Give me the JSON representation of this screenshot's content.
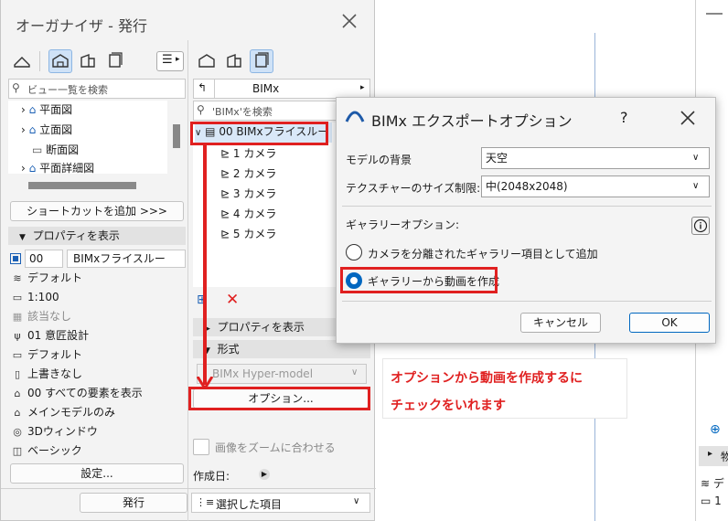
{
  "organizer": {
    "title": "オーガナイザ - 発行",
    "search_views_placeholder": "ビュー一覧を検索",
    "tree_left": [
      "平面図",
      "立面図",
      "断面図",
      "平面詳細図"
    ],
    "add_shortcut": "ショートカットを追加 >>>",
    "show_properties": "プロパティを表示",
    "prop_id": "00",
    "prop_name": "BIMxフライスルー",
    "properties": [
      "デフォルト",
      "1:100",
      "該当なし",
      "01 意匠設計",
      "デフォルト",
      "上書きなし",
      "00 すべての要素を表示",
      "メインモデルのみ",
      "3Dウィンドウ",
      "ベーシック"
    ],
    "settings_button": "設定...",
    "publish_button": "発行",
    "right_dropdown": "BIMx",
    "search_bimx_placeholder": "'BIMx'を検索",
    "set_item": "00 BIMxフライスルー",
    "cameras": [
      "1 カメラ",
      "2 カメラ",
      "3 カメラ",
      "4 カメラ",
      "5 カメラ"
    ],
    "right_show_properties": "プロパティを表示",
    "format_header": "形式",
    "format_value": "BIMx Hyper-model",
    "options_button": "オプション...",
    "fit_zoom": "画像をズームに合わせる",
    "created_date": "作成日:",
    "selected_items": "選択した項目"
  },
  "dialog": {
    "title": "BIMx エクスポートオプション",
    "help": "?",
    "model_bg_label": "モデルの背景",
    "model_bg_value": "天空",
    "texture_label": "テクスチャーのサイズ制限:",
    "texture_value": "中(2048x2048)",
    "gallery_label": "ギャラリーオプション:",
    "radio1": "カメラを分離されたギャラリー項目として追加",
    "radio2": "ギャラリーから動画を作成",
    "cancel": "キャンセル",
    "ok": "OK"
  },
  "annotation": {
    "line1": "オプションから動画を作成するに",
    "line2": "チェックをいれます"
  },
  "background": {
    "col_label_1": "物",
    "col_label_2": "デ",
    "col_label_3": "1"
  },
  "colors": {
    "accent": "#0067c0",
    "annotation_red": "#e02020",
    "highlight": "#cfe2f7"
  }
}
